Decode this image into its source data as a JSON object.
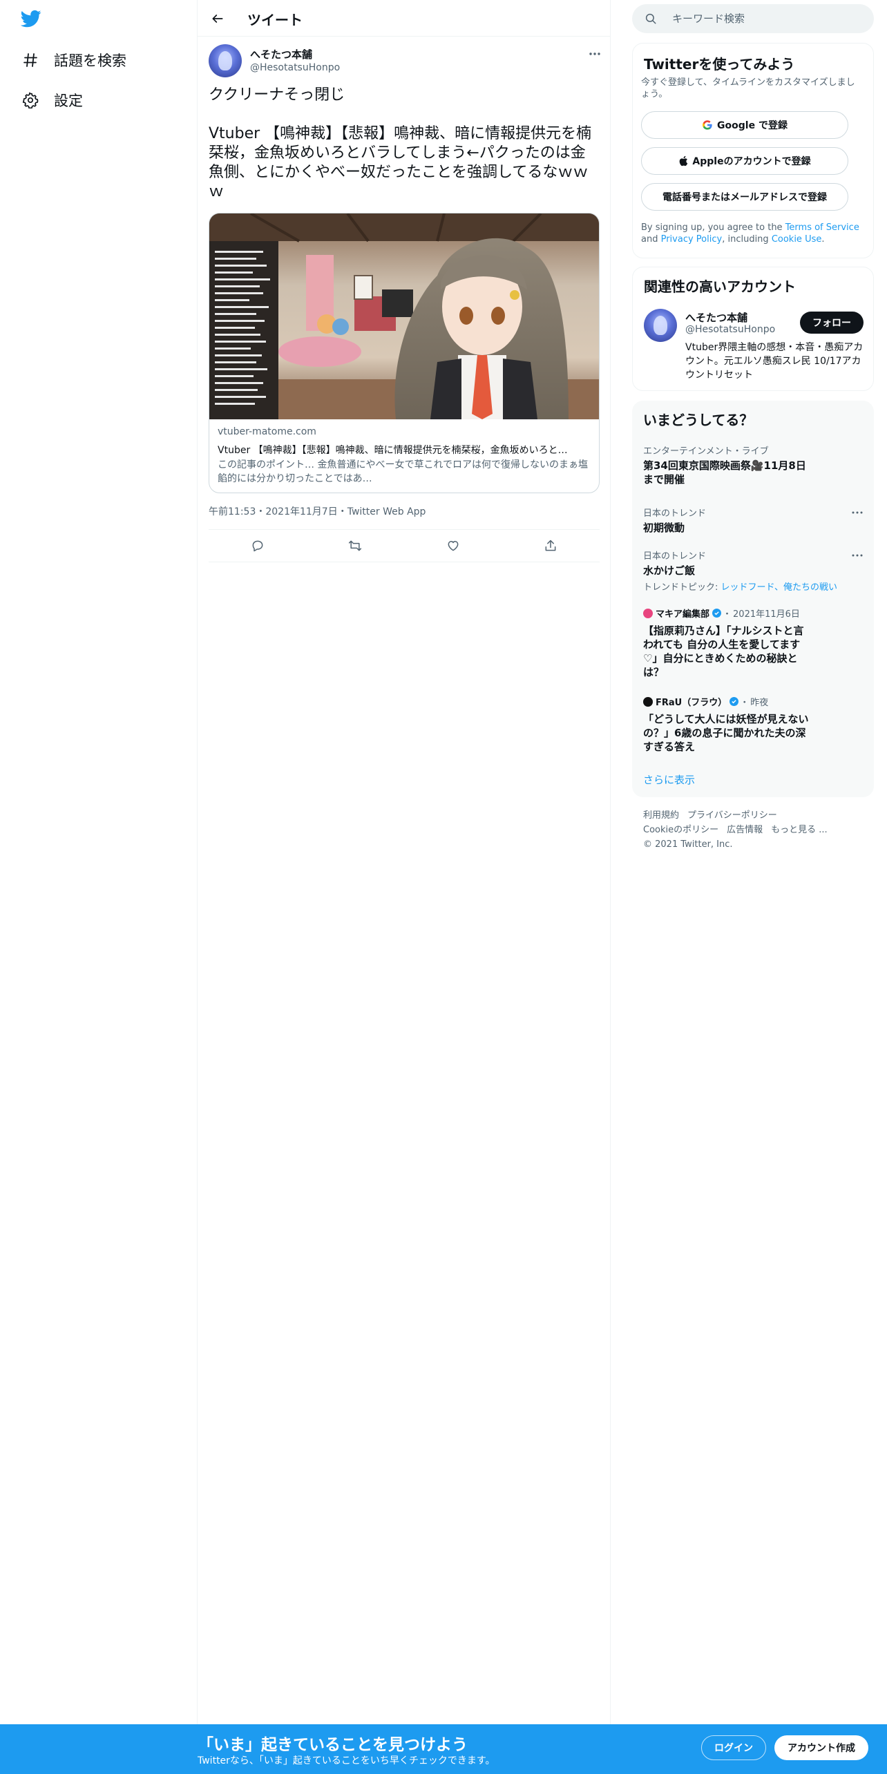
{
  "nav": {
    "items": [
      {
        "label": "話題を検索",
        "icon": "hashtag-icon"
      },
      {
        "label": "設定",
        "icon": "gear-icon"
      }
    ]
  },
  "header": {
    "title": "ツイート"
  },
  "tweet": {
    "author_name": "へそたつ本舗",
    "author_handle": "@HesotatsuHonpo",
    "text": "ククリーナそっ閉じ\n\nVtuber 【鳴神裁】【悲報】鳴神裁、暗に情報提供元を楠栞桜，金魚坂めいろとバラしてしまう←パクったのは金魚側、とにかくやべー奴だったことを強調してるなｗｗｗ",
    "card": {
      "domain": "vtuber-matome.com",
      "title": "Vtuber 【鳴神裁】【悲報】鳴神裁、暗に情報提供元を楠栞桜，金魚坂めいろと…",
      "description": "この記事のポイント… 金魚普通にやべー女で草これでロアは何で復帰しないのまぁ塩餡的には分かり切ったことではあ…"
    },
    "time": "午前11:53",
    "date": "2021年11月7日",
    "source": "Twitter Web App",
    "sep": "・"
  },
  "search": {
    "placeholder": "キーワード検索"
  },
  "signup": {
    "title": "Twitterを使ってみよう",
    "subtitle": "今すぐ登録して、タイムラインをカスタマイズしましょう。",
    "google": "Google で登録",
    "apple": "Appleのアカウントで登録",
    "email": "電話番号またはメールアドレスで登録",
    "terms_prefix": "By signing up, you agree to the ",
    "terms_link": "Terms of Service",
    "terms_and": " and ",
    "privacy_link": "Privacy Policy",
    "terms_including": ", including ",
    "cookie_link": "Cookie Use",
    "terms_end": "."
  },
  "related": {
    "title": "関連性の高いアカウント",
    "name": "へそたつ本舗",
    "handle": "@HesotatsuHonpo",
    "follow": "フォロー",
    "bio": "Vtuber界隈主軸の感想・本音・愚痴アカウント。元エルソ愚痴スレ民 10/17アカウントリセット"
  },
  "trends": {
    "title": "いまどうしてる？",
    "items": [
      {
        "category": "エンターテインメント・ライブ",
        "name": "第34回東京国際映画祭🎥11月8日まで開催"
      },
      {
        "category": "日本のトレンド",
        "name": "初期微動"
      },
      {
        "category": "日本のトレンド",
        "name": "水かけご飯",
        "topic_prefix": "トレンドトピック: ",
        "topic_links": "レッドフード、俺たちの戦い"
      }
    ],
    "news": [
      {
        "source": "マキア編集部",
        "date": "2021年11月6日",
        "headline": "【指原莉乃さん】「ナルシストと言われても 自分の人生を愛してます♡」自分にときめくための秘訣とは？"
      },
      {
        "source": "FRaU（フラウ）",
        "date": "昨夜",
        "headline": "「どうして大人には妖怪が見えないの？」6歳の息子に聞かれた夫の深すぎる答え"
      }
    ],
    "show_more": "さらに表示"
  },
  "footer": {
    "terms": "利用規約",
    "privacy": "プライバシーポリシー",
    "cookie": "Cookieのポリシー",
    "ads": "広告情報",
    "more": "もっと見る ...",
    "copyright": "© 2021 Twitter, Inc."
  },
  "bottom": {
    "title": "「いま」起きていることを見つけよう",
    "subtitle": "Twitterなら、「いま」起きていることをいち早くチェックできます。",
    "login": "ログイン",
    "signup": "アカウント作成"
  },
  "colors": {
    "accent": "#1d9bf0",
    "text": "#0f1419",
    "muted": "#536471",
    "border": "#eff3f4"
  }
}
